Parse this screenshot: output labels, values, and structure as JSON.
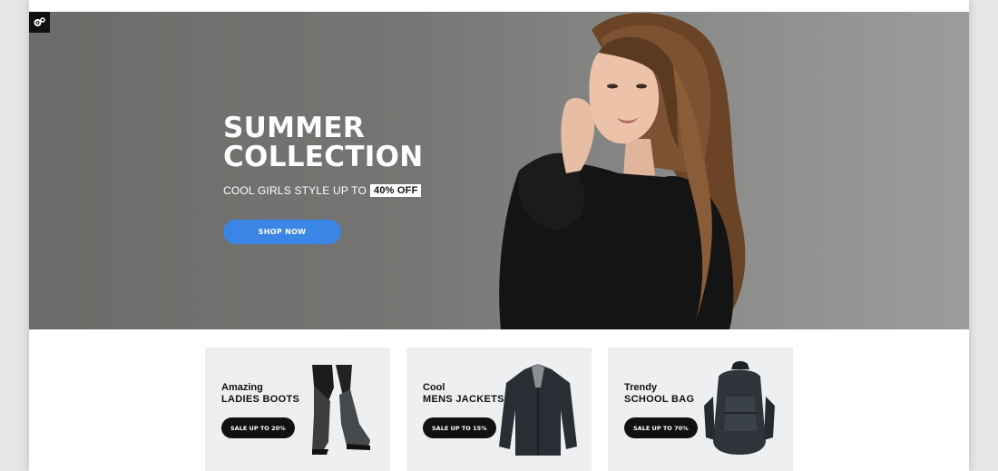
{
  "hero": {
    "title_line1": "SUMMER",
    "title_line2": "COLLECTION",
    "subtitle": "COOL GIRLS STYLE UP TO",
    "badge": "40% OFF",
    "cta_label": "SHOP NOW",
    "settings_icon": "gears-icon"
  },
  "cards": [
    {
      "pre": "Amazing",
      "title": "LADIES BOOTS",
      "button": "SALE UP TO 20%",
      "image": "boots"
    },
    {
      "pre": "Cool",
      "title": "MENS JACKETS",
      "button": "SALE UP TO 15%",
      "image": "jacket"
    },
    {
      "pre": "Trendy",
      "title": "SCHOOL BAG",
      "button": "SALE UP TO 70%",
      "image": "backpack"
    }
  ],
  "colors": {
    "accent": "#3a85e6",
    "card_bg": "#edeff1",
    "button_dark": "#111111"
  }
}
